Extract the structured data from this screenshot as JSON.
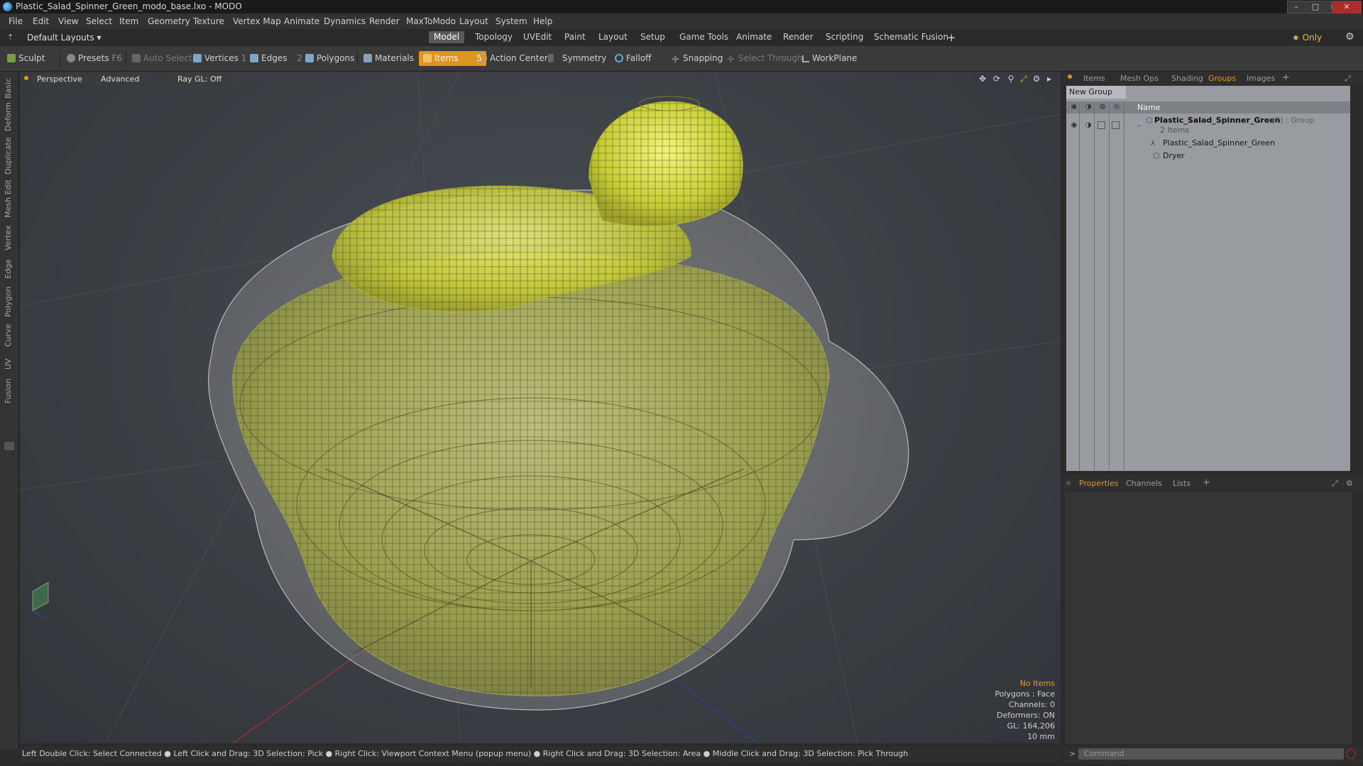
{
  "window": {
    "title": "Plastic_Salad_Spinner_Green_modo_base.lxo - MODO"
  },
  "menu": [
    "File",
    "Edit",
    "View",
    "Select",
    "Item",
    "Geometry",
    "Texture",
    "Vertex Map",
    "Animate",
    "Dynamics",
    "Render",
    "MaxToModo",
    "Layout",
    "System",
    "Help"
  ],
  "layout": {
    "default_layouts": "Default Layouts ▾",
    "tabs": [
      "Model",
      "Topology",
      "UVEdit",
      "Paint",
      "Layout",
      "Setup",
      "Game Tools",
      "Animate",
      "Render",
      "Scripting",
      "Schematic Fusion"
    ],
    "active_tab": "Model",
    "only_label": "★  Only"
  },
  "toolbar": {
    "sculpt": "Sculpt",
    "presets": "Presets",
    "presets_key": "F6",
    "auto_select": "Auto Select",
    "vertices": "Vertices",
    "vertices_count": "1",
    "edges": "Edges",
    "edges_count": "2",
    "polygons": "Polygons",
    "materials": "Materials",
    "items": "Items",
    "items_count": "5",
    "action_center": "Action Center",
    "symmetry": "Symmetry",
    "falloff": "Falloff",
    "snapping": "Snapping",
    "select_through": "Select Through",
    "workplane": "WorkPlane"
  },
  "left_tabs": [
    "Basic",
    "Deform",
    "Duplicate",
    "Mesh Edit",
    "Vertex",
    "Edge",
    "Polygon",
    "Curve",
    "UV",
    "Fusion"
  ],
  "viewport": {
    "perspective": "Perspective",
    "advanced": "Advanced",
    "raygl": "Ray GL: Off",
    "stats": {
      "no_items": "No Items",
      "polygons": "Polygons : Face",
      "channels": "Channels: 0",
      "deformers": "Deformers: ON",
      "gl": "GL: 164,206",
      "scale": "10 mm"
    }
  },
  "status": "Left Double Click: Select Connected ● Left Click and Drag: 3D Selection: Pick ● Right Click: Viewport Context Menu (popup menu) ● Right Click and Drag: 3D Selection: Area ● Middle Click and Drag: 3D Selection: Pick Through",
  "right_panel": {
    "tabs": [
      "Items",
      "Mesh Ops",
      "Shading",
      "Groups",
      "Images"
    ],
    "active_tab": "Groups",
    "new_group": "New Group",
    "name_header": "Name",
    "group_name": "Plastic_Salad_Spinner_Green",
    "group_suffix": "(2) : Group",
    "group_count": "2 Items",
    "children": [
      "Plastic_Salad_Spinner_Green",
      "Dryer"
    ],
    "prop_tabs": [
      "Properties",
      "Channels",
      "Lists"
    ],
    "prop_active": "Properties",
    "command_placeholder": "Command"
  },
  "colors": {
    "accent": "#e0961c",
    "model_yellow": "#d6dd3a"
  }
}
